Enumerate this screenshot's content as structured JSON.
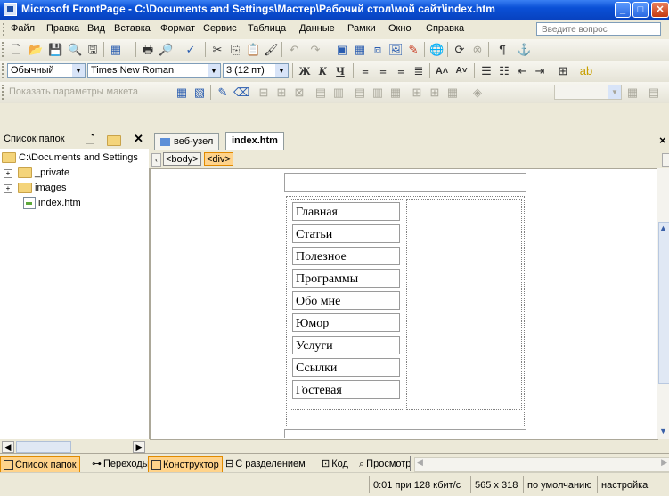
{
  "window": {
    "title": "Microsoft FrontPage - C:\\Documents and Settings\\Мастер\\Рабочий стол\\мой сайт\\index.htm"
  },
  "menu": {
    "items": [
      "Файл",
      "Правка",
      "Вид",
      "Вставка",
      "Формат",
      "Сервис",
      "Таблица",
      "Данные",
      "Рамки",
      "Окно",
      "Справка"
    ],
    "ask_placeholder": "Введите вопрос"
  },
  "formatting": {
    "style": "Обычный",
    "font": "Times New Roman",
    "size": "3 (12 пт)"
  },
  "tables_toolbar": {
    "show_layout": "Показать параметры макета"
  },
  "folder_panel": {
    "title": "Список папок",
    "root": "C:\\Documents and Settings",
    "items": [
      "_private",
      "images",
      "index.htm"
    ]
  },
  "editor": {
    "tabs": [
      "веб-узел",
      "index.htm"
    ],
    "tags": [
      "<body>",
      "<div>"
    ],
    "nav_buttons": [
      "Главная",
      "Статьи",
      "Полезное",
      "Программы",
      "Обо мне",
      "Юмор",
      "Услуги",
      "Ссылки",
      "Гостевая"
    ]
  },
  "panel_tabs": {
    "folders": "Список папок",
    "navigation": "Переходы"
  },
  "view_tabs": {
    "design": "Конструктор",
    "split": "С разделением",
    "code": "Код",
    "preview": "Просмотр"
  },
  "status": {
    "speed": "0:01 при 128 кбит/с",
    "resolution": "565 x 318",
    "default": "по умолчанию",
    "custom": "настройка"
  }
}
